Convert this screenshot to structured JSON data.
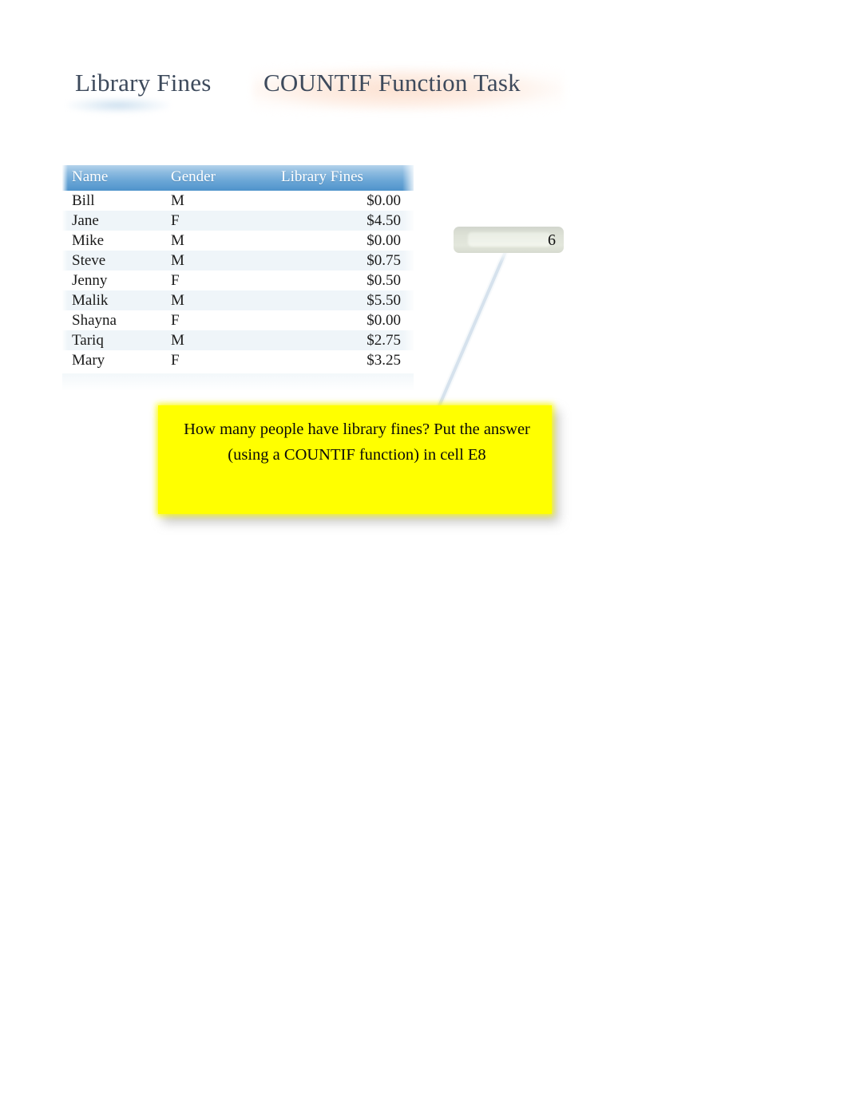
{
  "document": {
    "titles": {
      "left": "Library Fines",
      "right": "COUNTIF Function Task"
    }
  },
  "table": {
    "columns": [
      "Name",
      "Gender",
      "Library Fines"
    ],
    "rows": [
      {
        "name": "Bill",
        "gender": "M",
        "fine": "$0.00"
      },
      {
        "name": "Jane",
        "gender": "F",
        "fine": "$4.50"
      },
      {
        "name": "Mike",
        "gender": "M",
        "fine": "$0.00"
      },
      {
        "name": "Steve",
        "gender": "M",
        "fine": "$0.75"
      },
      {
        "name": "Jenny",
        "gender": "F",
        "fine": "$0.50"
      },
      {
        "name": "Malik",
        "gender": "M",
        "fine": "$5.50"
      },
      {
        "name": "Shayna",
        "gender": "F",
        "fine": "$0.00"
      },
      {
        "name": "Tariq",
        "gender": "M",
        "fine": "$2.75"
      },
      {
        "name": "Mary",
        "gender": "F",
        "fine": "$3.25"
      }
    ]
  },
  "answer_cell": {
    "value": "6"
  },
  "callout": {
    "text": "How many people have library fines? Put the answer (using a COUNTIF function) in cell E8"
  },
  "colors": {
    "title_text": "#3d4a5c",
    "title_left_glow": "#c4daec",
    "title_right_glow": "#fce0cf",
    "header_top": "#b4d3ec",
    "header_bottom": "#4f93cb",
    "header_text": "#ffffff",
    "row_stripe": "#e2edf4",
    "cell_text": "#1a1a1a",
    "answer_cell_bg": "#dee2d7",
    "callout_bg": "#ffff00",
    "callout_text": "#0a0a0a",
    "connector_line": "#c6d8e6"
  }
}
